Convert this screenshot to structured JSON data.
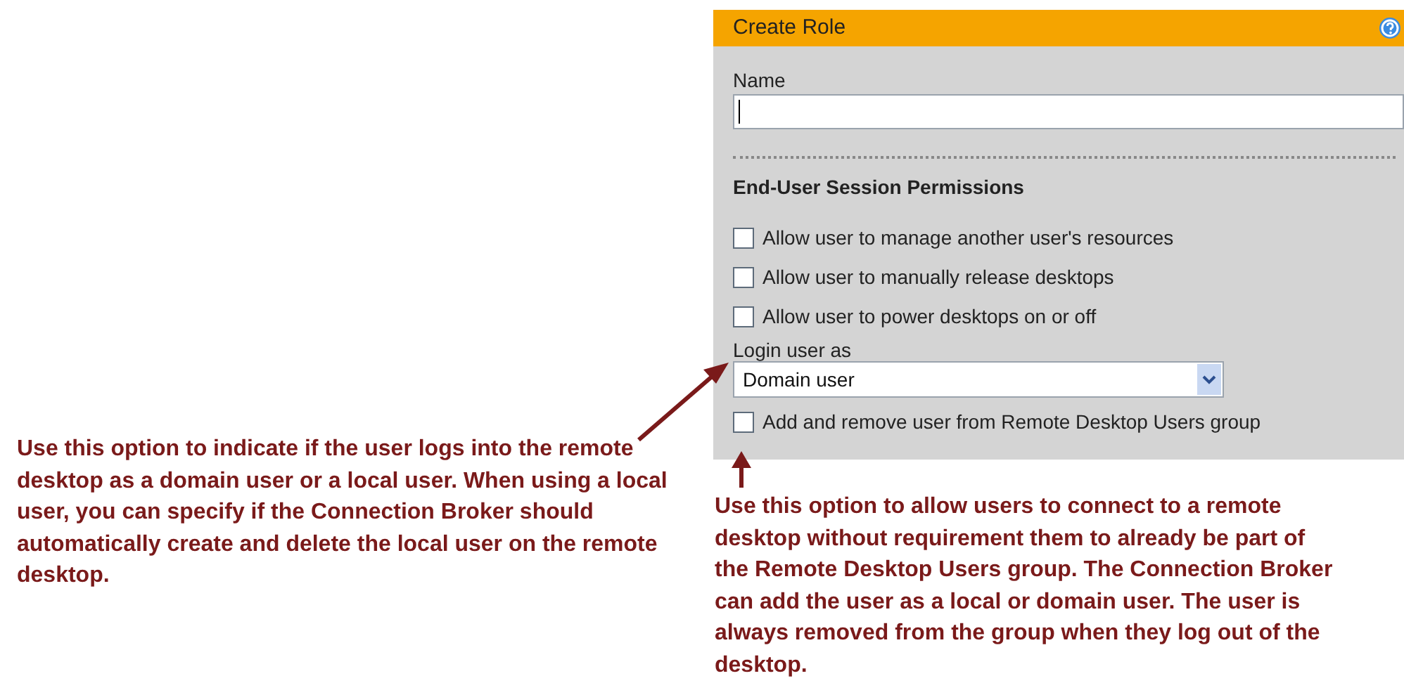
{
  "dialog": {
    "title": "Create Role",
    "name_field": {
      "label": "Name"
    },
    "section_title": "End-User Session Permissions",
    "permissions": [
      {
        "label": "Allow user to manage another user's resources",
        "checked": false
      },
      {
        "label": "Allow user to manually release desktops",
        "checked": false
      },
      {
        "label": "Allow user to power desktops on or off",
        "checked": false
      }
    ],
    "login_as": {
      "label": "Login user as",
      "value": "Domain user"
    },
    "group_option": {
      "label": "Add and remove user from Remote Desktop Users group",
      "checked": false
    }
  },
  "callouts": [
    {
      "text": "Use this option to indicate if the user logs into the remote desktop as a domain user or a local user. When using a local user, you can specify if the Connection Broker should automatically create and delete the local user on the remote desktop."
    },
    {
      "text": "Use this option to allow users to connect to a remote desktop without requirement them to already be part of the Remote Desktop Users group. The Connection Broker can add the user as a local or domain user. The user is always removed from the group when they log out of the desktop."
    }
  ]
}
